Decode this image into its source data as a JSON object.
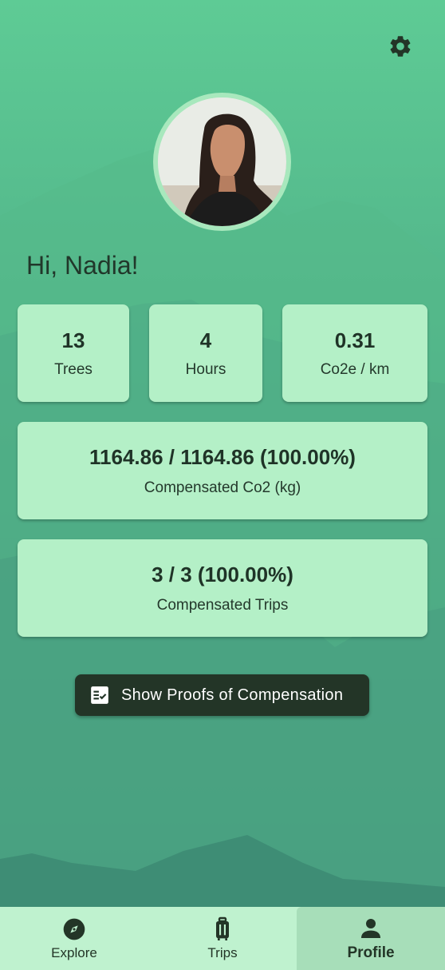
{
  "header": {
    "settings_icon": "gear-icon"
  },
  "profile": {
    "greeting": "Hi, Nadia!",
    "avatar_description": "profile photo"
  },
  "stats": [
    {
      "value": "13",
      "label": "Trees"
    },
    {
      "value": "4",
      "label": "Hours"
    },
    {
      "value": "0.31",
      "label": "Co2e / km"
    }
  ],
  "co2": {
    "value": "1164.86 / 1164.86 (100.00%)",
    "label": "Compensated Co2 (kg)"
  },
  "trips": {
    "value": "3 / 3 (100.00%)",
    "label": "Compensated Trips"
  },
  "proof_button": {
    "label": "Show Proofs of Compensation",
    "icon": "checklist-icon"
  },
  "nav": [
    {
      "label": "Explore",
      "icon": "compass-icon",
      "active": false
    },
    {
      "label": "Trips",
      "icon": "luggage-icon",
      "active": false
    },
    {
      "label": "Profile",
      "icon": "person-icon",
      "active": true
    }
  ],
  "colors": {
    "background_top": "#5ecb95",
    "background_bottom": "#3d8a76",
    "card": "#b4f0c7",
    "button_dark": "#233527",
    "navbar": "#bff2cf",
    "nav_active": "#a7deb9"
  }
}
